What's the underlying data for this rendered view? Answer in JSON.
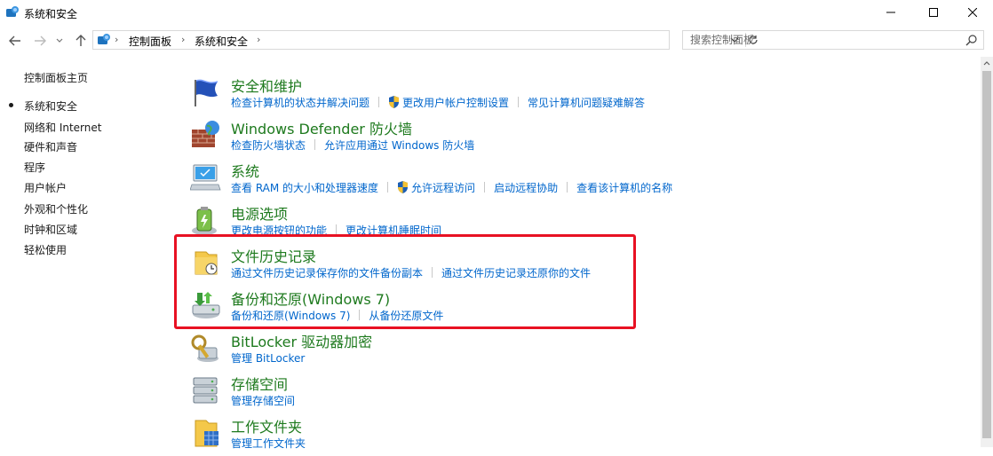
{
  "window": {
    "title": "系统和安全"
  },
  "nav": {
    "breadcrumb": [
      "控制面板",
      "系统和安全"
    ],
    "search_placeholder": "搜索控制面板"
  },
  "sidebar": {
    "items": [
      {
        "label": "控制面板主页"
      },
      {
        "label": "系统和安全",
        "current": true
      },
      {
        "label": "网络和 Internet"
      },
      {
        "label": "硬件和声音"
      },
      {
        "label": "程序"
      },
      {
        "label": "用户帐户"
      },
      {
        "label": "外观和个性化"
      },
      {
        "label": "时钟和区域"
      },
      {
        "label": "轻松使用"
      }
    ]
  },
  "categories": [
    {
      "title": "安全和维护",
      "icon": "flag-icon",
      "links": [
        "检查计算机的状态并解决问题",
        "更改用户帐户控制设置",
        "常见计算机问题疑难解答"
      ]
    },
    {
      "title": "Windows Defender 防火墙",
      "icon": "firewall-icon",
      "links": [
        "检查防火墙状态",
        "允许应用通过 Windows 防火墙"
      ]
    },
    {
      "title": "系统",
      "icon": "computer-icon",
      "links": [
        "查看 RAM 的大小和处理器速度",
        "允许远程访问",
        "启动远程协助",
        "查看该计算机的名称"
      ]
    },
    {
      "title": "电源选项",
      "icon": "battery-icon",
      "links": [
        "更改电源按钮的功能",
        "更改计算机睡眠时间"
      ]
    },
    {
      "title": "文件历史记录",
      "icon": "file-history-icon",
      "links": [
        "通过文件历史记录保存你的文件备份副本",
        "通过文件历史记录还原你的文件"
      ]
    },
    {
      "title": "备份和还原(Windows 7)",
      "icon": "backup-icon",
      "links": [
        "备份和还原(Windows 7)",
        "从备份还原文件"
      ]
    },
    {
      "title": "BitLocker 驱动器加密",
      "icon": "bitlocker-icon",
      "links": [
        "管理 BitLocker"
      ]
    },
    {
      "title": "存储空间",
      "icon": "storage-icon",
      "links": [
        "管理存储空间"
      ]
    },
    {
      "title": "工作文件夹",
      "icon": "work-folder-icon",
      "links": [
        "管理工作文件夹"
      ]
    }
  ],
  "colors": {
    "title_green": "#1e7a1e",
    "link_blue": "#0066cc",
    "highlight_red": "#e81123"
  }
}
